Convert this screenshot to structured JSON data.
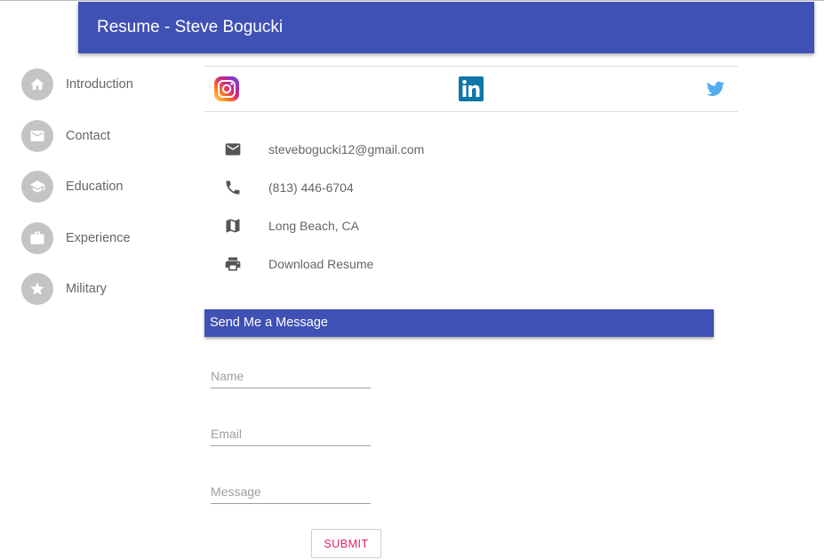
{
  "header": {
    "title": "Resume - Steve Bogucki",
    "color": "#3f51b5"
  },
  "sidebar": {
    "items": [
      {
        "label": "Introduction",
        "icon": "home-icon"
      },
      {
        "label": "Contact",
        "icon": "mail-icon"
      },
      {
        "label": "Education",
        "icon": "school-icon"
      },
      {
        "label": "Experience",
        "icon": "briefcase-icon"
      },
      {
        "label": "Military",
        "icon": "star-icon"
      }
    ]
  },
  "social": {
    "links": [
      "instagram-icon",
      "linkedin-icon",
      "twitter-icon"
    ]
  },
  "contact": {
    "email": "stevebogucki12@gmail.com",
    "phone": "(813) 446-6704",
    "location": "Long Beach, CA",
    "download": "Download Resume"
  },
  "message_form": {
    "title": "Send Me a Message",
    "name_placeholder": "Name",
    "email_placeholder": "Email",
    "message_placeholder": "Message",
    "submit_label": "SUBMIT",
    "accent_color": "#e91e63"
  }
}
